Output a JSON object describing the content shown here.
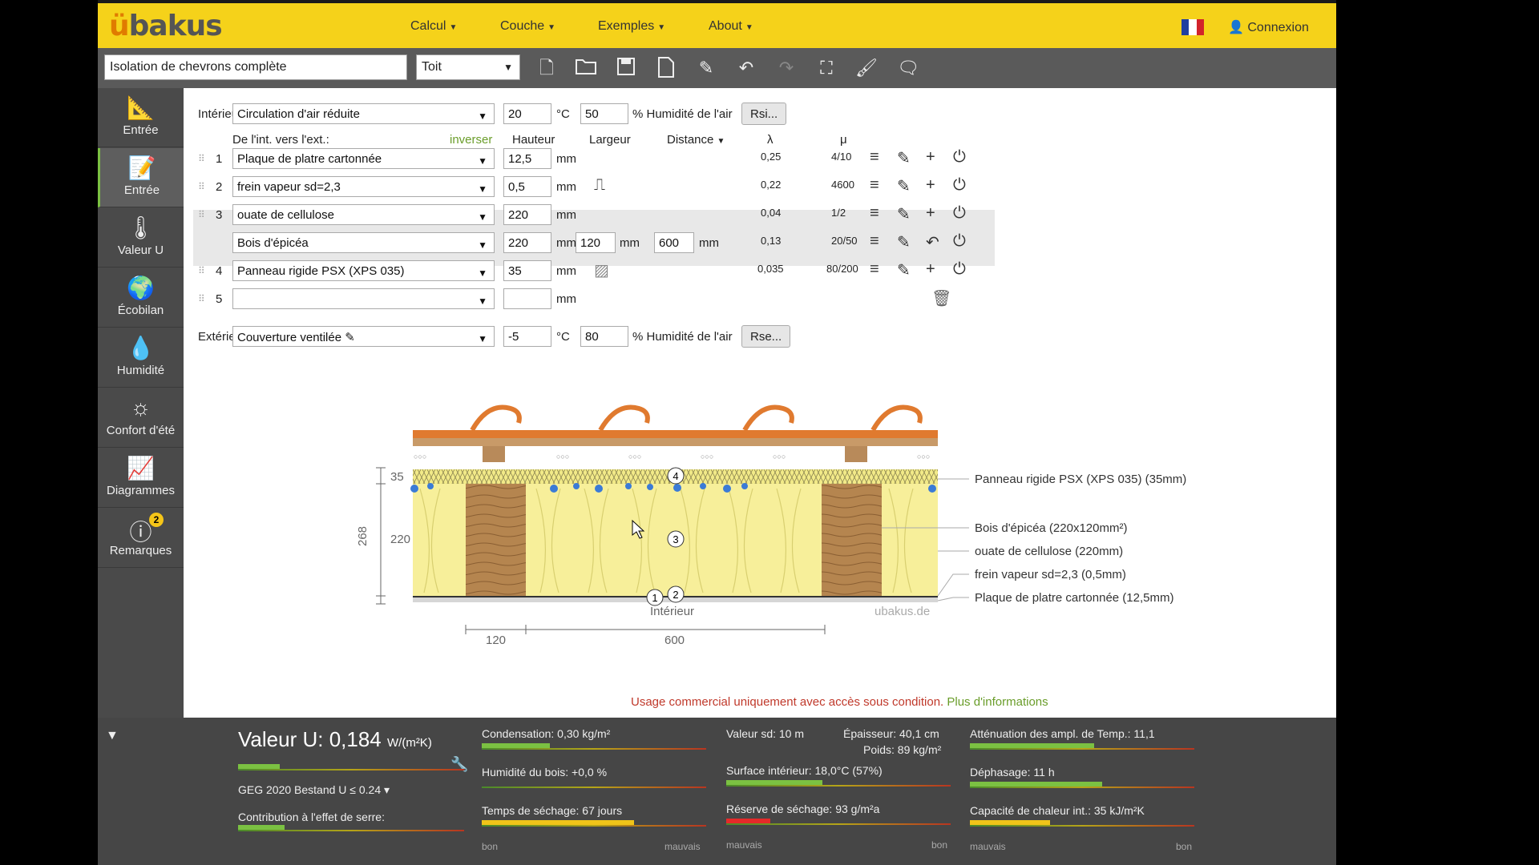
{
  "app": {
    "logo": "ubakus",
    "menu": [
      "Calcul",
      "Couche",
      "Exemples",
      "About"
    ],
    "login": "Connexion"
  },
  "toolbar": {
    "title": "Isolation de chevrons complète",
    "type": "Toit"
  },
  "sidebar": {
    "items": [
      "Entrée",
      "Entrée",
      "Valeur U",
      "Écobilan",
      "Humidité",
      "Confort d'été",
      "Diagrammes",
      "Remarques"
    ],
    "badge": "2"
  },
  "interior": {
    "label": "Intérieur",
    "select": "Circulation d'air réduite",
    "temp": "20",
    "temp_unit": "°C",
    "humidity": "50",
    "humidity_label": "% Humidité de l'air",
    "button": "Rsi..."
  },
  "headers": {
    "direction": "De l'int. vers l'ext.:",
    "invert": "inverser",
    "height": "Hauteur",
    "width": "Largeur",
    "distance": "Distance",
    "lambda": "λ",
    "mu": "μ"
  },
  "layers": [
    {
      "n": "1",
      "material": "Plaque de platre cartonnée",
      "h": "12,5",
      "unit": "mm",
      "lambda": "0,25",
      "mu": "4/10"
    },
    {
      "n": "2",
      "material": "frein vapeur sd=2,3",
      "h": "0,5",
      "unit": "mm",
      "lambda": "0,22",
      "mu": "4600"
    },
    {
      "n": "3",
      "material": "ouate de cellulose",
      "h": "220",
      "unit": "mm",
      "lambda": "0,04",
      "mu": "1/2"
    },
    {
      "n": "",
      "material": "Bois d'épicéa",
      "h": "220",
      "unit": "mm",
      "w": "120",
      "w_unit": "mm",
      "d": "600",
      "d_unit": "mm",
      "lambda": "0,13",
      "mu": "20/50"
    },
    {
      "n": "4",
      "material": "Panneau rigide PSX (XPS 035)",
      "h": "35",
      "unit": "mm",
      "lambda": "0,035",
      "mu": "80/200"
    },
    {
      "n": "5",
      "material": "",
      "h": "",
      "unit": "mm"
    }
  ],
  "exterior": {
    "label": "Extérieur",
    "select": "Couverture ventilée",
    "temp": "-5",
    "temp_unit": "°C",
    "humidity": "80",
    "humidity_label": "% Humidité de l'air",
    "button": "Rse..."
  },
  "drawing": {
    "dim_35": "35",
    "dim_220": "220",
    "dim_268": "268",
    "dim_120": "120",
    "dim_600": "600",
    "interior_label": "Intérieur",
    "watermark": "ubakus.de",
    "markers": [
      "4",
      "3",
      "1",
      "2"
    ],
    "labels": [
      "Panneau rigide PSX (XPS 035) (35mm)",
      "Bois d'épicéa (220x120mm²)",
      "ouate de cellulose (220mm)",
      "frein vapeur sd=2,3 (0,5mm)",
      "Plaque de platre cartonnée (12,5mm)"
    ]
  },
  "notice": {
    "text": "Usage commercial uniquement avec accès sous condition.",
    "link": "Plus d'informations"
  },
  "results": {
    "u_label": "Valeur U:",
    "u_value": "0,184",
    "u_unit": "W/(m²K)",
    "geg": "GEG 2020 Bestand U ≤ 0.24",
    "greenhouse": "Contribution à l'effet de serre:",
    "condensation": "Condensation: 0,30 kg/m²",
    "wood_humidity": "Humidité du bois: +0,0 %",
    "drying_time": "Temps de séchage: 67 jours",
    "sd": "Valeur sd: 10 m",
    "thickness": "Épaisseur: 40,1 cm",
    "weight": "Poids: 89 kg/m²",
    "surface": "Surface intérieur: 18,0°C (57%)",
    "drying_reserve": "Réserve de séchage: 93 g/m²a",
    "attenuation": "Atténuation des ampl. de Temp.: 11,1",
    "phase": "Déphasage: 11 h",
    "heat_capacity": "Capacité de chaleur int.: 35 kJ/m²K",
    "good": "bon",
    "bad": "mauvais"
  },
  "colors": {
    "topbar": "#f5d21a",
    "sidebar": "#4a4a4a",
    "accent": "#7bc142",
    "insulation": "#f7ef9a",
    "wood": "#b88a5a",
    "roof": "#e07a2f"
  }
}
